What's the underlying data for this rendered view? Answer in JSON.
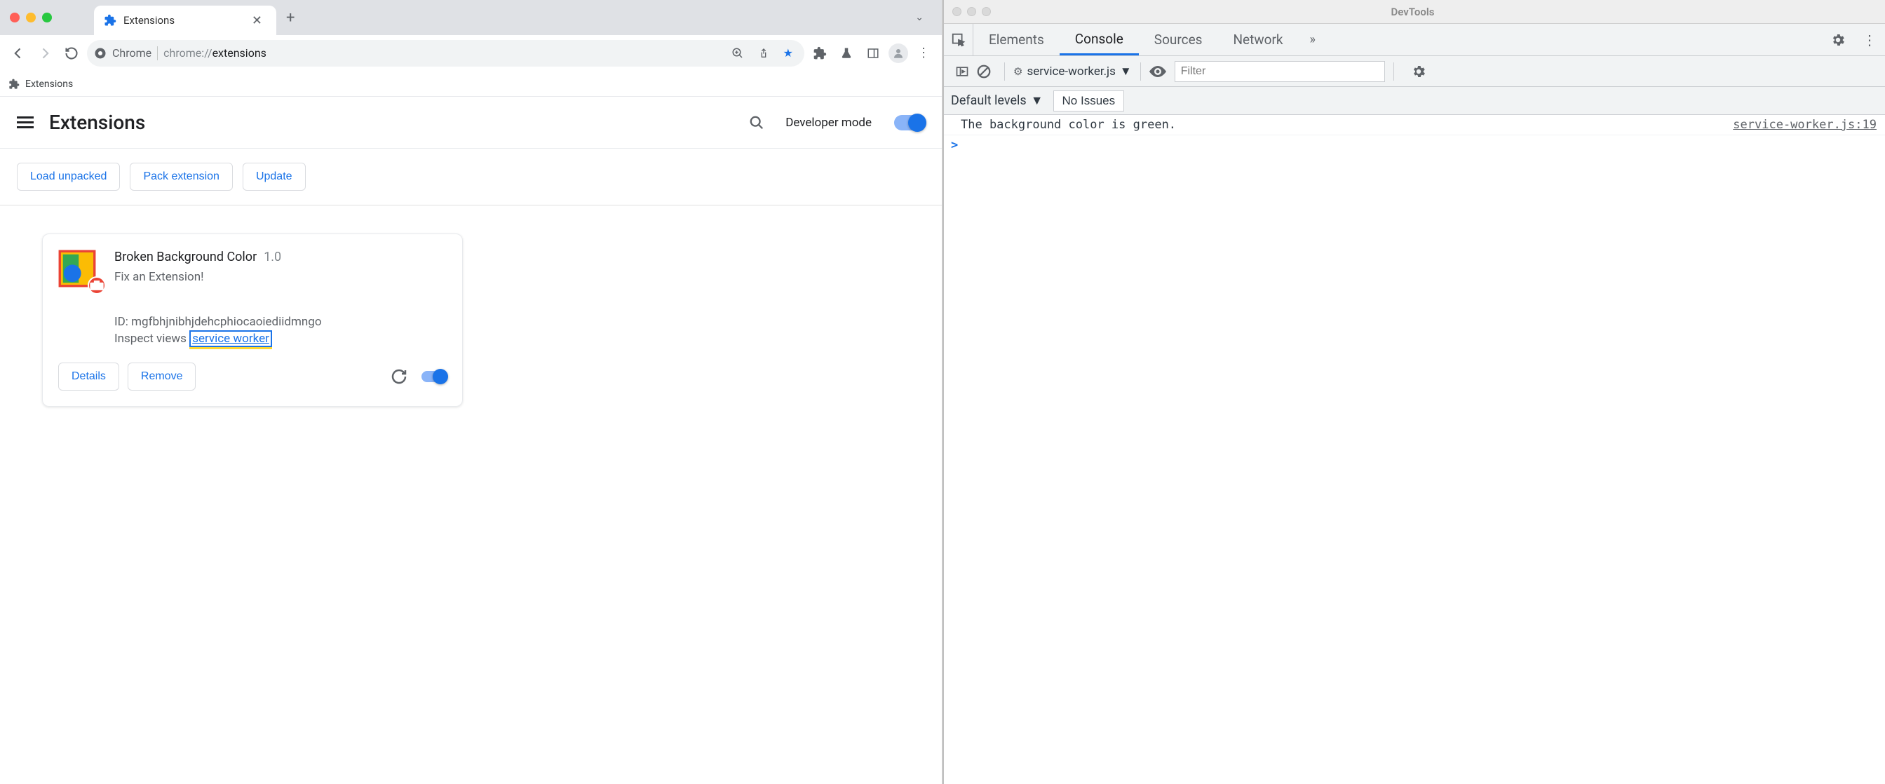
{
  "chrome": {
    "tab_title": "Extensions",
    "omnibox_label": "Chrome",
    "url_dim": "chrome://",
    "url_strong": "extensions",
    "bookmark": "Extensions",
    "page_title": "Extensions",
    "dev_mode_label": "Developer mode",
    "buttons": {
      "load_unpacked": "Load unpacked",
      "pack_extension": "Pack extension",
      "update": "Update"
    },
    "extension": {
      "name": "Broken Background Color",
      "version": "1.0",
      "description": "Fix an Extension!",
      "id_label": "ID:",
      "id_value": "mgfbhjnibhjdehcphiocaoiediidmngo",
      "inspect_label": "Inspect views",
      "inspect_link": "service worker",
      "details": "Details",
      "remove": "Remove"
    }
  },
  "devtools": {
    "title": "DevTools",
    "tabs": {
      "elements": "Elements",
      "console": "Console",
      "sources": "Sources",
      "network": "Network"
    },
    "context": "service-worker.js",
    "filter_placeholder": "Filter",
    "levels": "Default levels",
    "no_issues": "No Issues",
    "log_message": "The background color is green.",
    "log_source": "service-worker.js:19"
  }
}
